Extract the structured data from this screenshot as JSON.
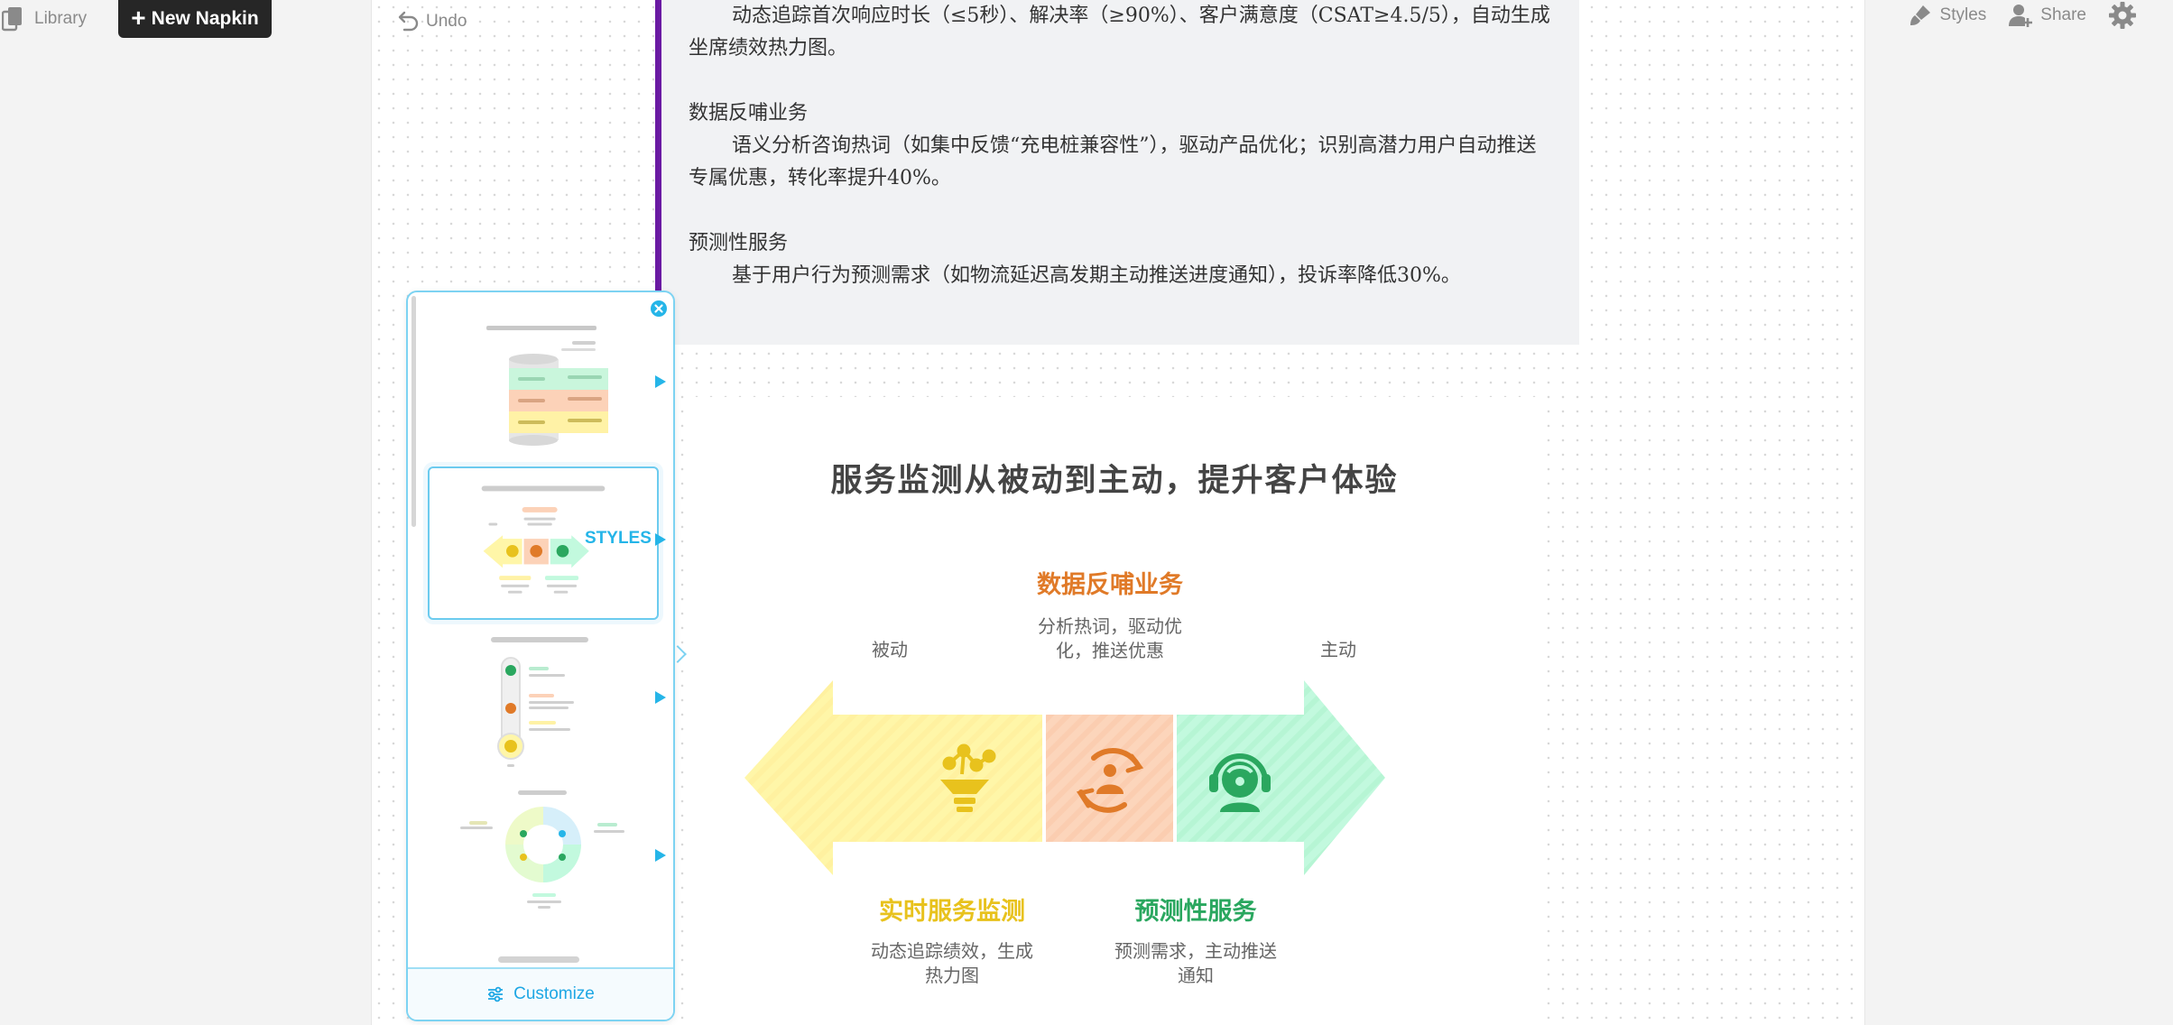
{
  "topbar": {
    "library_label": "Library",
    "new_napkin_label": "New Napkin",
    "undo_label": "Undo",
    "styles_label": "Styles",
    "share_label": "Share",
    "icons": [
      "library-icon",
      "plus-icon",
      "undo-icon",
      "brush-icon",
      "add-user-icon",
      "gear-icon"
    ]
  },
  "document": {
    "paragraph1_body": "动态追踪首次响应时长（≤5秒）、解决率（≥90%）、客户满意度（CSAT≥4.5/5），自动生成坐席绩效热力图。",
    "section2_heading": "数据反哺业务",
    "section2_body": "语义分析咨询热词（如集中反馈“充电桩兼容性”），驱动产品优化；识别高潜力用户自动推送专属优惠，转化率提升40%。",
    "section3_heading": "预测性服务",
    "section3_body": "基于用户行为预测需求（如物流延迟高发期主动推送进度通知），投诉率降低30%。"
  },
  "diagram": {
    "title": "服务监测从被动到主动，提升客户体验",
    "passive_label": "被动",
    "active_label": "主动",
    "center_heading": "数据反哺业务",
    "center_desc_line1": "分析热词，驱动优",
    "center_desc_line2": "化，推送优惠",
    "left_heading": "实时服务监测",
    "left_desc_line1": "动态追踪绩效，生成",
    "left_desc_line2": "热力图",
    "right_heading": "预测性服务",
    "right_desc_line1": "预测需求，主动推送",
    "right_desc_line2": "通知",
    "colors": {
      "left": "#fff6a8",
      "center": "#fcd3b8",
      "right": "#bff8dc",
      "left_icon": "#e8c21d",
      "center_icon": "#e07a28",
      "right_icon": "#2aa75f"
    }
  },
  "styles_panel": {
    "styles_tag": "STYLES",
    "customize_label": "Customize",
    "accent_color": "#25b5e8"
  }
}
